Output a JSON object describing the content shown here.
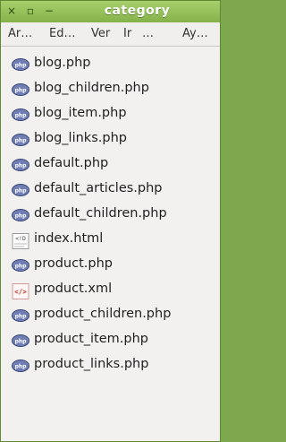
{
  "window": {
    "title": "category"
  },
  "titlebar": {
    "close_glyph": "×",
    "maximize_glyph": "▫",
    "minimize_glyph": "−"
  },
  "menu": {
    "items": [
      "Ar…",
      "Ed…",
      "Ver",
      "Ir",
      "…",
      "Ay…"
    ]
  },
  "files": [
    {
      "name": "blog.php",
      "icon": "php-file-icon"
    },
    {
      "name": "blog_children.php",
      "icon": "php-file-icon"
    },
    {
      "name": "blog_item.php",
      "icon": "php-file-icon"
    },
    {
      "name": "blog_links.php",
      "icon": "php-file-icon"
    },
    {
      "name": "default.php",
      "icon": "php-file-icon"
    },
    {
      "name": "default_articles.php",
      "icon": "php-file-icon"
    },
    {
      "name": "default_children.php",
      "icon": "php-file-icon"
    },
    {
      "name": "index.html",
      "icon": "html-file-icon"
    },
    {
      "name": "product.php",
      "icon": "php-file-icon"
    },
    {
      "name": "product.xml",
      "icon": "xml-file-icon"
    },
    {
      "name": "product_children.php",
      "icon": "php-file-icon"
    },
    {
      "name": "product_item.php",
      "icon": "php-file-icon"
    },
    {
      "name": "product_links.php",
      "icon": "php-file-icon"
    }
  ],
  "colors": {
    "titlebar_top": "#a7cf6b",
    "titlebar_bottom": "#84b24a",
    "background": "#f2f1ef"
  }
}
